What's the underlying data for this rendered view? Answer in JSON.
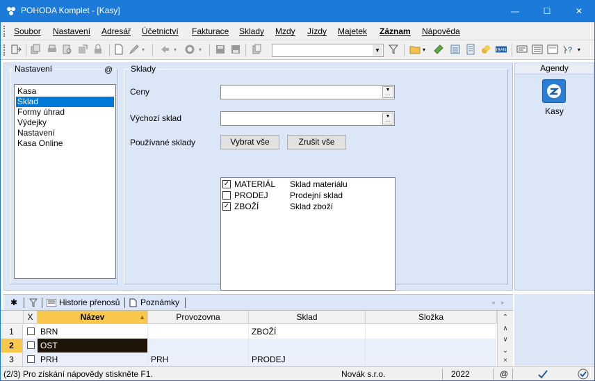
{
  "window": {
    "title": "POHODA Komplet - [Kasy]",
    "minimize_glyph": "—",
    "maximize_glyph": "☐",
    "close_glyph": "✕"
  },
  "menu": {
    "items": [
      "Soubor",
      "Nastavení",
      "Adresář",
      "Účetnictví",
      "Fakturace",
      "Sklady",
      "Mzdy",
      "Jízdy",
      "Majetek",
      "Záznam",
      "Nápověda"
    ]
  },
  "toolbar": {
    "combo_value": "",
    "icons": [
      "agenda-icon",
      "copy-record-icon",
      "print-icon",
      "print-preview-icon",
      "export-icon",
      "lock-icon",
      "new-record-icon",
      "edit-icon",
      "back-icon",
      "settings-icon",
      "save-icon",
      "save-as-icon",
      "paste-icon",
      "filter-icon",
      "folder-icon",
      "money-icon",
      "calculator-icon",
      "table-icon",
      "coins-icon",
      "iban-icon",
      "message-icon",
      "list-icon",
      "form-icon",
      "help-icon"
    ]
  },
  "settings_panel": {
    "caption": "Nastavení",
    "at_sign": "@",
    "nav_items": [
      "Kasa",
      "Sklad",
      "Formy úhrad",
      "Výdejky",
      "Nastavení",
      "Kasa Online"
    ],
    "selected_index": 1
  },
  "sklady": {
    "caption": "Sklady",
    "ceny_label": "Ceny",
    "ceny_value": "",
    "vychozi_label": "Výchozí sklad",
    "vychozi_value": "",
    "pouzivane_label": "Používané sklady",
    "select_all_label": "Vybrat vše",
    "clear_all_label": "Zrušit vše",
    "stores": [
      {
        "code": "MATERIÁL",
        "name": "Sklad materiálu",
        "checked": true
      },
      {
        "code": "PRODEJ",
        "name": "Prodejní sklad",
        "checked": false
      },
      {
        "code": "ZBOŽÍ",
        "name": "Sklad zboží",
        "checked": true
      }
    ]
  },
  "agenda": {
    "header": "Agendy",
    "item_label": "Kasy"
  },
  "tabs": {
    "history_label": "Historie přenosů",
    "notes_label": "Poznámky"
  },
  "grid": {
    "headers": {
      "x": "X",
      "nazev": "Název",
      "provozovna": "Provozovna",
      "sklad": "Sklad",
      "slozka": "Složka"
    },
    "rows": [
      {
        "num": "1",
        "nazev": "BRN",
        "provozovna": "",
        "sklad": "ZBOŽÍ",
        "slozka": ""
      },
      {
        "num": "2",
        "nazev": "OST",
        "provozovna": "",
        "sklad": "",
        "slozka": ""
      },
      {
        "num": "3",
        "nazev": "PRH",
        "provozovna": "PRH",
        "sklad": "PRODEJ",
        "slozka": ""
      }
    ],
    "active_row": 1
  },
  "status": {
    "help_text": "(2/3) Pro získání nápovědy stiskněte F1.",
    "company": "Novák s.r.o.",
    "year": "2022",
    "at_sign": "@"
  },
  "colors": {
    "title_bar": "#1c7bd9",
    "selection": "#0078d7",
    "panel_bg": "#dbe6f7",
    "sort_highlight": "#f9c74b"
  }
}
